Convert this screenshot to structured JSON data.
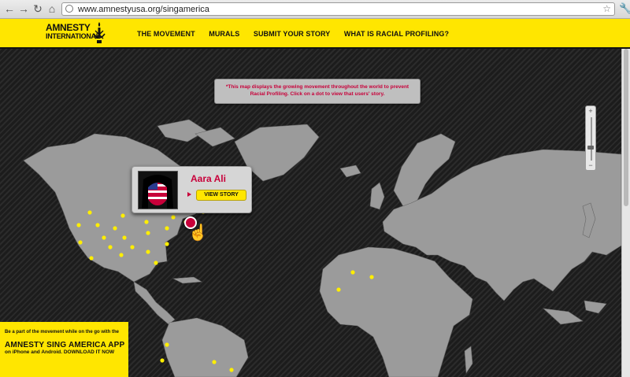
{
  "browser": {
    "url": "www.amnestyusa.org/singamerica"
  },
  "header": {
    "logo_line1": "AMNESTY",
    "logo_line2": "INTERNATIONAL",
    "nav": [
      "THE MOVEMENT",
      "MURALS",
      "SUBMIT YOUR STORY",
      "WHAT IS RACIAL PROFILING?"
    ]
  },
  "notice": {
    "text": "*This map displays the growing movement throughout the world to prevent Racial Profiling. Click on a dot to view that users' story."
  },
  "popup": {
    "name": "Aara Ali",
    "button": "VIEW STORY"
  },
  "promo": {
    "line1": "Be a part of the movement while on the go with the",
    "line2": "AMNESTY SING AMERICA APP",
    "line3": "on iPhone and Android. DOWNLOAD IT NOW"
  },
  "zoom": {
    "plus": "+",
    "minus": "−"
  },
  "colors": {
    "brand_yellow": "#ffe600",
    "accent_red": "#c8003a",
    "land": "#9b9b9b",
    "story_dot": "#ffee00"
  },
  "icons": {
    "back": "back-arrow-icon",
    "forward": "forward-arrow-icon",
    "reload": "reload-icon",
    "home": "home-icon",
    "star": "bookmark-star-icon",
    "wrench": "wrench-icon",
    "logo": "candle-logo-icon",
    "cursor": "hand-cursor-icon"
  }
}
